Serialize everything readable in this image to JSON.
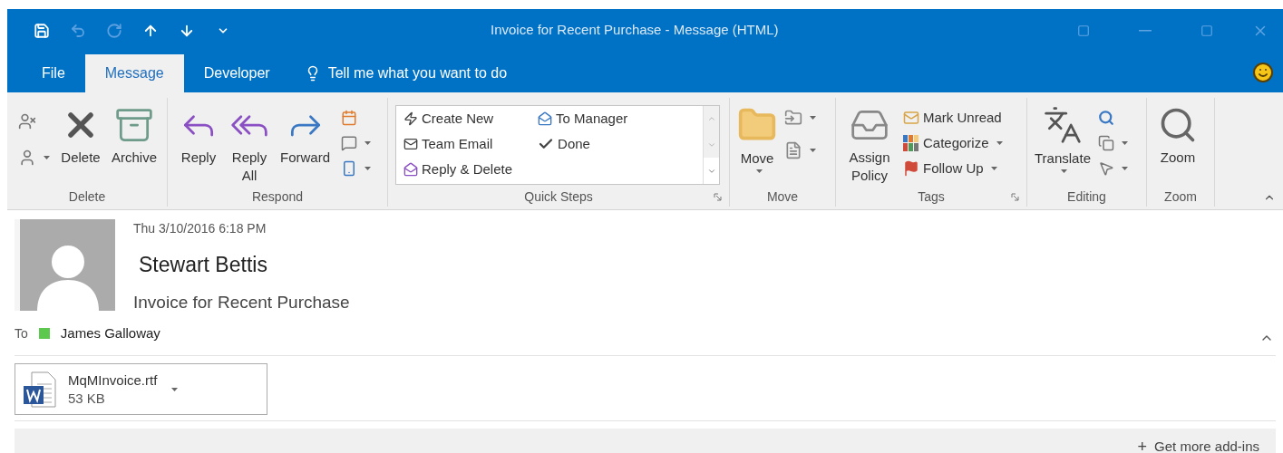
{
  "window": {
    "title": "Invoice for Recent Purchase - Message (HTML)"
  },
  "quick_access": [
    {
      "kind": "save",
      "disabled": false
    },
    {
      "kind": "undo",
      "disabled": true
    },
    {
      "kind": "redo",
      "disabled": true
    },
    {
      "kind": "up",
      "disabled": false
    },
    {
      "kind": "down",
      "disabled": false
    },
    {
      "kind": "customize",
      "disabled": false
    }
  ],
  "tabs": [
    {
      "label": "File",
      "selected": false
    },
    {
      "label": "Message",
      "selected": true
    },
    {
      "label": "Developer",
      "selected": false
    }
  ],
  "tell_me": {
    "text": "Tell me what you want to do"
  },
  "ribbon": {
    "groups": [
      {
        "kind": "delete",
        "label": "Delete",
        "launcher": false,
        "items": [
          {
            "label": "Delete"
          },
          {
            "label": "Archive"
          }
        ]
      },
      {
        "kind": "respond",
        "label": "Respond",
        "launcher": false,
        "items": [
          {
            "label": "Reply"
          },
          {
            "label": "Reply All"
          },
          {
            "label": "Forward"
          }
        ]
      },
      {
        "kind": "quick_steps",
        "label": "Quick Steps",
        "launcher": true,
        "items": [
          {
            "label": "Create New"
          },
          {
            "label": "Team Email"
          },
          {
            "label": "Reply & Delete"
          },
          {
            "label": "To Manager"
          },
          {
            "label": "Done"
          }
        ]
      },
      {
        "kind": "move",
        "label": "Move",
        "launcher": false,
        "items": [
          {
            "label": "Move"
          }
        ]
      },
      {
        "kind": "tags",
        "label": "Tags",
        "launcher": true,
        "items": [
          {
            "label": "Assign Policy"
          },
          {
            "label": "Mark Unread"
          },
          {
            "label": "Categorize"
          },
          {
            "label": "Follow Up"
          }
        ]
      },
      {
        "kind": "editing",
        "label": "Editing",
        "launcher": false,
        "items": [
          {
            "label": "Translate"
          }
        ]
      },
      {
        "kind": "zoom",
        "label": "Zoom",
        "launcher": false,
        "items": [
          {
            "label": "Zoom"
          }
        ]
      }
    ]
  },
  "message": {
    "date": "Thu 3/10/2016 6:18 PM",
    "sender": "Stewart Bettis",
    "subject": "Invoice for Recent Purchase",
    "to_label": "To",
    "recipients": [
      {
        "name": "James Galloway",
        "color": "#5cc84e"
      }
    ],
    "attachment": {
      "name": "MqMInvoice.rtf",
      "size": "53 KB"
    }
  },
  "footer": {
    "icon": "+",
    "text": "Get more add-ins"
  }
}
